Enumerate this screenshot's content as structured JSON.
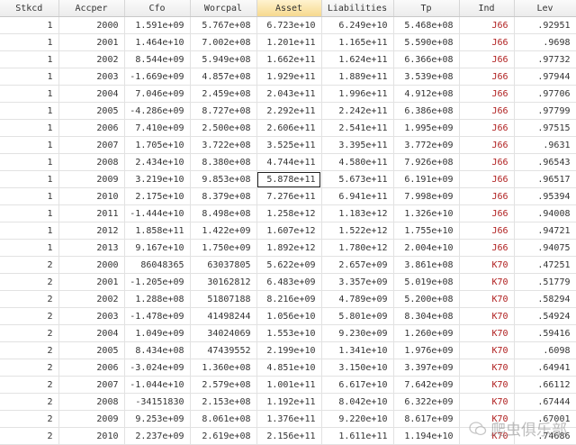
{
  "columns": [
    "Stkcd",
    "Accper",
    "Cfo",
    "Worcpal",
    "Asset",
    "Liabilities",
    "Tp",
    "Ind",
    "Lev"
  ],
  "active_column": "Asset",
  "selected_cell": {
    "row": 9,
    "column": "Asset"
  },
  "colors": {
    "ind_text": "#b02020",
    "active_header": "#f6d98e"
  },
  "rows": [
    [
      "1",
      "2000",
      "1.591e+09",
      "5.767e+08",
      "6.723e+10",
      "6.249e+10",
      "5.468e+08",
      "J66",
      ".92951"
    ],
    [
      "1",
      "2001",
      "1.464e+10",
      "7.002e+08",
      "1.201e+11",
      "1.165e+11",
      "5.590e+08",
      "J66",
      ".9698"
    ],
    [
      "1",
      "2002",
      "8.544e+09",
      "5.949e+08",
      "1.662e+11",
      "1.624e+11",
      "6.366e+08",
      "J66",
      ".97732"
    ],
    [
      "1",
      "2003",
      "-1.669e+09",
      "4.857e+08",
      "1.929e+11",
      "1.889e+11",
      "3.539e+08",
      "J66",
      ".97944"
    ],
    [
      "1",
      "2004",
      "7.046e+09",
      "2.459e+08",
      "2.043e+11",
      "1.996e+11",
      "4.912e+08",
      "J66",
      ".97706"
    ],
    [
      "1",
      "2005",
      "-4.286e+09",
      "8.727e+08",
      "2.292e+11",
      "2.242e+11",
      "6.386e+08",
      "J66",
      ".97799"
    ],
    [
      "1",
      "2006",
      "7.410e+09",
      "2.500e+08",
      "2.606e+11",
      "2.541e+11",
      "1.995e+09",
      "J66",
      ".97515"
    ],
    [
      "1",
      "2007",
      "1.705e+10",
      "3.722e+08",
      "3.525e+11",
      "3.395e+11",
      "3.772e+09",
      "J66",
      ".9631"
    ],
    [
      "1",
      "2008",
      "2.434e+10",
      "8.380e+08",
      "4.744e+11",
      "4.580e+11",
      "7.926e+08",
      "J66",
      ".96543"
    ],
    [
      "1",
      "2009",
      "3.219e+10",
      "9.853e+08",
      "5.878e+11",
      "5.673e+11",
      "6.191e+09",
      "J66",
      ".96517"
    ],
    [
      "1",
      "2010",
      "2.175e+10",
      "8.379e+08",
      "7.276e+11",
      "6.941e+11",
      "7.998e+09",
      "J66",
      ".95394"
    ],
    [
      "1",
      "2011",
      "-1.444e+10",
      "8.498e+08",
      "1.258e+12",
      "1.183e+12",
      "1.326e+10",
      "J66",
      ".94008"
    ],
    [
      "1",
      "2012",
      "1.858e+11",
      "1.422e+09",
      "1.607e+12",
      "1.522e+12",
      "1.755e+10",
      "J66",
      ".94721"
    ],
    [
      "1",
      "2013",
      "9.167e+10",
      "1.750e+09",
      "1.892e+12",
      "1.780e+12",
      "2.004e+10",
      "J66",
      ".94075"
    ],
    [
      "2",
      "2000",
      "86048365",
      "63037805",
      "5.622e+09",
      "2.657e+09",
      "3.861e+08",
      "K70",
      ".47251"
    ],
    [
      "2",
      "2001",
      "-1.205e+09",
      "30162812",
      "6.483e+09",
      "3.357e+09",
      "5.019e+08",
      "K70",
      ".51779"
    ],
    [
      "2",
      "2002",
      "1.288e+08",
      "51807188",
      "8.216e+09",
      "4.789e+09",
      "5.200e+08",
      "K70",
      ".58294"
    ],
    [
      "2",
      "2003",
      "-1.478e+09",
      "41498244",
      "1.056e+10",
      "5.801e+09",
      "8.304e+08",
      "K70",
      ".54924"
    ],
    [
      "2",
      "2004",
      "1.049e+09",
      "34024069",
      "1.553e+10",
      "9.230e+09",
      "1.260e+09",
      "K70",
      ".59416"
    ],
    [
      "2",
      "2005",
      "8.434e+08",
      "47439552",
      "2.199e+10",
      "1.341e+10",
      "1.976e+09",
      "K70",
      ".6098"
    ],
    [
      "2",
      "2006",
      "-3.024e+09",
      "1.360e+08",
      "4.851e+10",
      "3.150e+10",
      "3.397e+09",
      "K70",
      ".64941"
    ],
    [
      "2",
      "2007",
      "-1.044e+10",
      "2.579e+08",
      "1.001e+11",
      "6.617e+10",
      "7.642e+09",
      "K70",
      ".66112"
    ],
    [
      "2",
      "2008",
      "-34151830",
      "2.153e+08",
      "1.192e+11",
      "8.042e+10",
      "6.322e+09",
      "K70",
      ".67444"
    ],
    [
      "2",
      "2009",
      "9.253e+09",
      "8.061e+08",
      "1.376e+11",
      "9.220e+10",
      "8.617e+09",
      "K70",
      ".67001"
    ],
    [
      "2",
      "2010",
      "2.237e+09",
      "2.619e+08",
      "2.156e+11",
      "1.611e+11",
      "1.194e+10",
      "K70",
      ".74686"
    ]
  ],
  "watermark": {
    "text": "爬虫俱乐部",
    "icon": "wechat-icon"
  }
}
